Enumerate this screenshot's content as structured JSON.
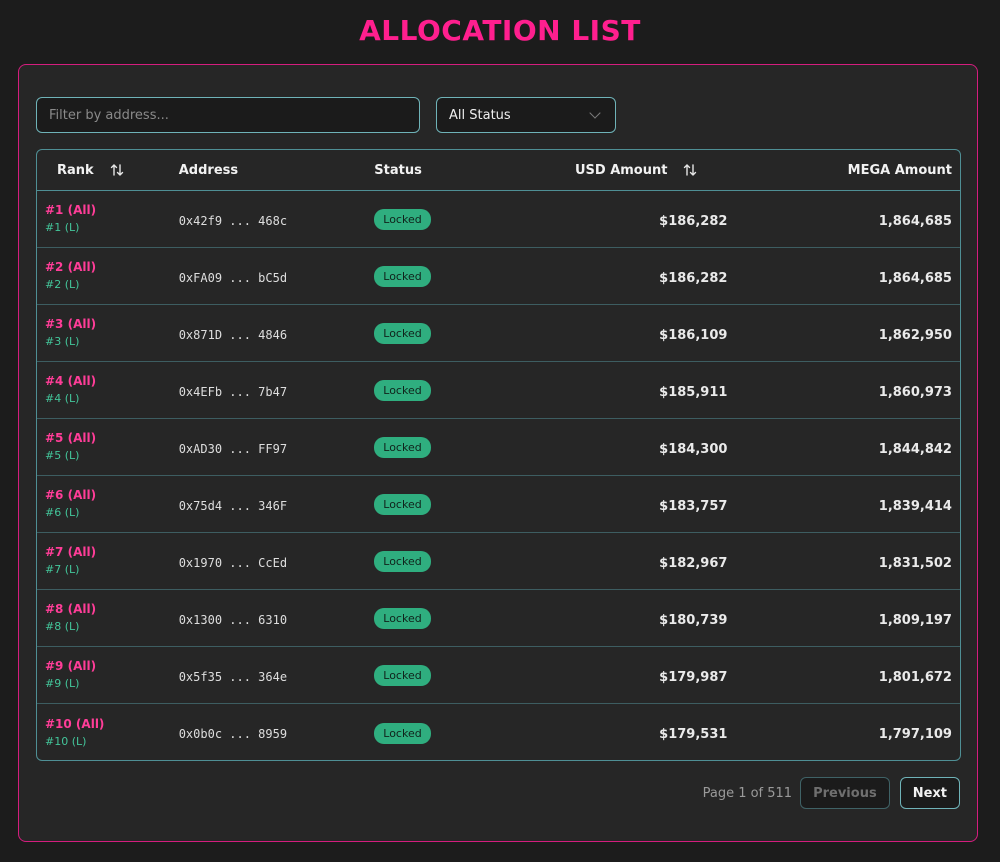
{
  "title": "ALLOCATION LIST",
  "filters": {
    "address_placeholder": "Filter by address...",
    "address_value": "",
    "status_selected": "All Status"
  },
  "table": {
    "headers": {
      "rank": "Rank",
      "address": "Address",
      "status": "Status",
      "usd": "USD Amount",
      "mega": "MEGA Amount"
    },
    "rows": [
      {
        "rank_all": "#1 (All)",
        "rank_l": "#1 (L)",
        "address": "0x42f9 ... 468c",
        "status": "Locked",
        "usd": "$186,282",
        "mega": "1,864,685"
      },
      {
        "rank_all": "#2 (All)",
        "rank_l": "#2 (L)",
        "address": "0xFA09 ... bC5d",
        "status": "Locked",
        "usd": "$186,282",
        "mega": "1,864,685"
      },
      {
        "rank_all": "#3 (All)",
        "rank_l": "#3 (L)",
        "address": "0x871D ... 4846",
        "status": "Locked",
        "usd": "$186,109",
        "mega": "1,862,950"
      },
      {
        "rank_all": "#4 (All)",
        "rank_l": "#4 (L)",
        "address": "0x4EFb ... 7b47",
        "status": "Locked",
        "usd": "$185,911",
        "mega": "1,860,973"
      },
      {
        "rank_all": "#5 (All)",
        "rank_l": "#5 (L)",
        "address": "0xAD30 ... FF97",
        "status": "Locked",
        "usd": "$184,300",
        "mega": "1,844,842"
      },
      {
        "rank_all": "#6 (All)",
        "rank_l": "#6 (L)",
        "address": "0x75d4 ... 346F",
        "status": "Locked",
        "usd": "$183,757",
        "mega": "1,839,414"
      },
      {
        "rank_all": "#7 (All)",
        "rank_l": "#7 (L)",
        "address": "0x1970 ... CcEd",
        "status": "Locked",
        "usd": "$182,967",
        "mega": "1,831,502"
      },
      {
        "rank_all": "#8 (All)",
        "rank_l": "#8 (L)",
        "address": "0x1300 ... 6310",
        "status": "Locked",
        "usd": "$180,739",
        "mega": "1,809,197"
      },
      {
        "rank_all": "#9 (All)",
        "rank_l": "#9 (L)",
        "address": "0x5f35 ... 364e",
        "status": "Locked",
        "usd": "$179,987",
        "mega": "1,801,672"
      },
      {
        "rank_all": "#10 (All)",
        "rank_l": "#10 (L)",
        "address": "0x0b0c ... 8959",
        "status": "Locked",
        "usd": "$179,531",
        "mega": "1,797,109"
      }
    ]
  },
  "pagination": {
    "info": "Page 1 of 511",
    "previous": "Previous",
    "next": "Next"
  },
  "colors": {
    "accent_pink": "#ff1f8e",
    "accent_teal": "#6fb3b8",
    "badge_green": "#2fae7f",
    "background": "#1c1c1c"
  },
  "icons": {
    "sort": "sort-icon",
    "dropdown": "chevron-down-icon"
  }
}
